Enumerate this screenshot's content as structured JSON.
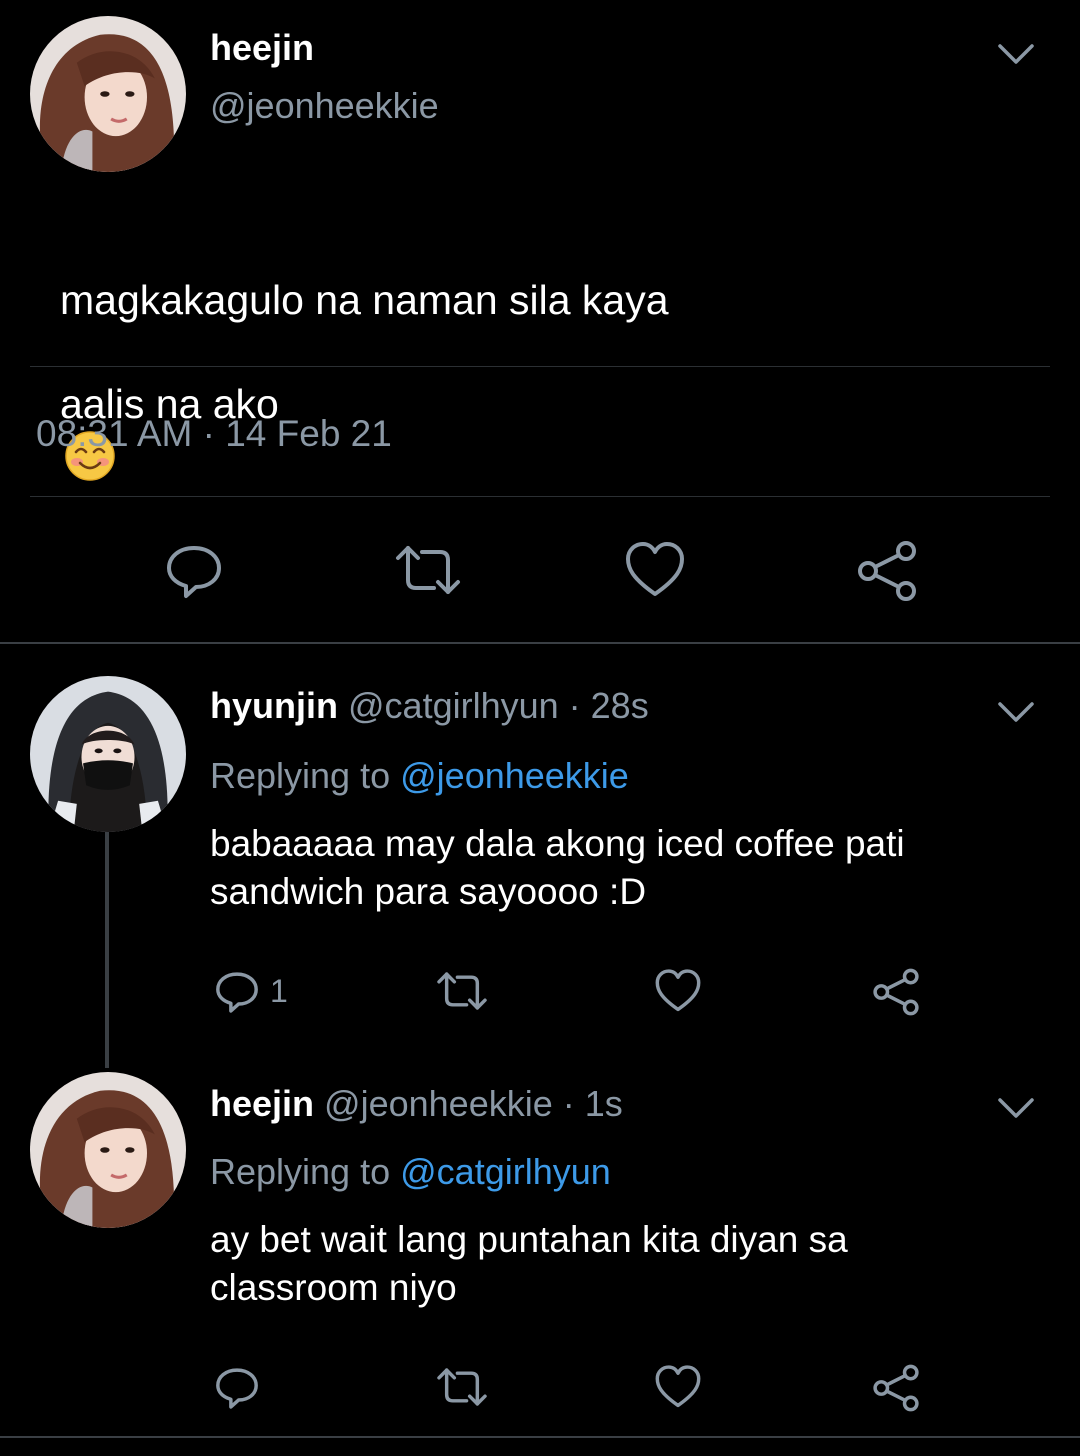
{
  "main_tweet": {
    "name": "heejin",
    "handle": "@jeonheekkie",
    "text_line1": "magkakagulo na naman sila kaya",
    "text_line2": "aalis na ako",
    "emoji": "smiling-face-with-smiling-eyes",
    "timestamp": "08:31 AM · 14 Feb 21",
    "actions": [
      "reply-icon",
      "retweet-icon",
      "like-icon",
      "share-icon"
    ]
  },
  "replies": [
    {
      "name": "hyunjin",
      "handle": "@catgirlhyun",
      "time": "· 28s",
      "replying_label": "Replying to",
      "replying_to": "@jeonheekkie",
      "text_line1": "babaaaaa may dala akong iced coffee pati",
      "text_line2": "sandwich para sayoooo :D",
      "reply_count": "1"
    },
    {
      "name": "heejin",
      "handle": "@jeonheekkie",
      "time": "· 1s",
      "replying_label": "Replying to",
      "replying_to": "@catgirlhyun",
      "text_line1": "ay bet wait lang puntahan kita diyan sa",
      "text_line2": "classroom niyo",
      "reply_count": ""
    }
  ],
  "colors": {
    "background": "#000000",
    "text_primary": "#ffffff",
    "text_secondary": "#8b98a5",
    "mention": "#3d9ae8",
    "divider": "#2b2f33"
  }
}
